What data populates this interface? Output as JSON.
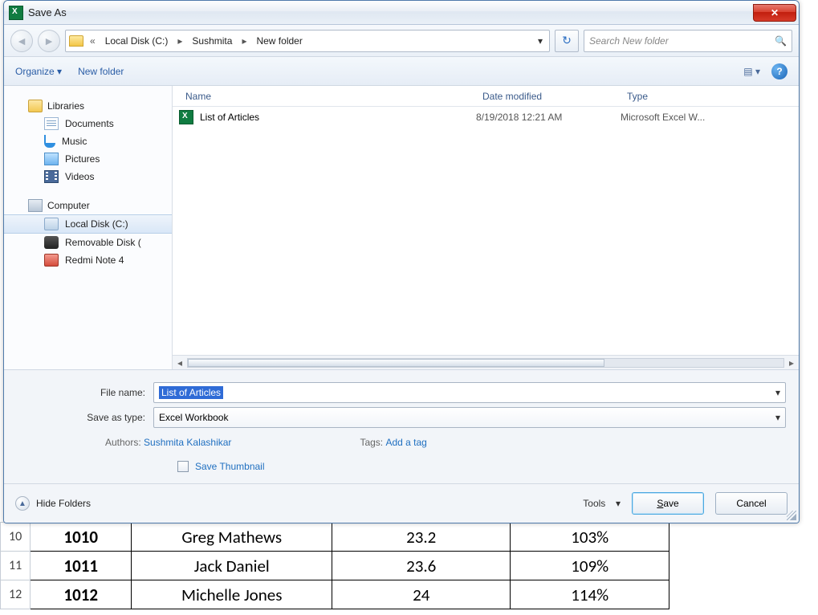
{
  "window": {
    "title": "Save As"
  },
  "nav": {
    "crumb_prefix": "«",
    "crumbs": [
      "Local Disk (C:)",
      "Sushmita",
      "New folder"
    ],
    "refresh_glyph": "↻",
    "search_placeholder": "Search New folder"
  },
  "toolbar": {
    "organize": "Organize",
    "new_folder": "New folder"
  },
  "sidebar": {
    "libraries": {
      "label": "Libraries",
      "items": [
        "Documents",
        "Music",
        "Pictures",
        "Videos"
      ]
    },
    "computer": {
      "label": "Computer",
      "items": [
        "Local Disk (C:)",
        "Removable Disk (",
        "Redmi Note 4"
      ]
    }
  },
  "columns": {
    "name": "Name",
    "date": "Date modified",
    "type": "Type"
  },
  "files": [
    {
      "name": "List of Articles",
      "date": "8/19/2018 12:21 AM",
      "type": "Microsoft Excel W..."
    }
  ],
  "form": {
    "file_name_label": "File name:",
    "file_name_value": "List of Articles",
    "save_type_label": "Save as type:",
    "save_type_value": "Excel Workbook",
    "authors_label": "Authors:",
    "authors_value": "Sushmita Kalashikar",
    "tags_label": "Tags:",
    "tags_value": "Add a tag",
    "save_thumbnail": "Save Thumbnail"
  },
  "buttons": {
    "hide_folders": "Hide Folders",
    "tools": "Tools",
    "save": "Save",
    "cancel": "Cancel"
  },
  "spreadsheet": {
    "rows": [
      {
        "n": "10",
        "a": "1010",
        "b": "Greg Mathews",
        "c": "23.2",
        "d": "103%"
      },
      {
        "n": "11",
        "a": "1011",
        "b": "Jack Daniel",
        "c": "23.6",
        "d": "109%"
      },
      {
        "n": "12",
        "a": "1012",
        "b": "Michelle Jones",
        "c": "24",
        "d": "114%"
      }
    ]
  }
}
